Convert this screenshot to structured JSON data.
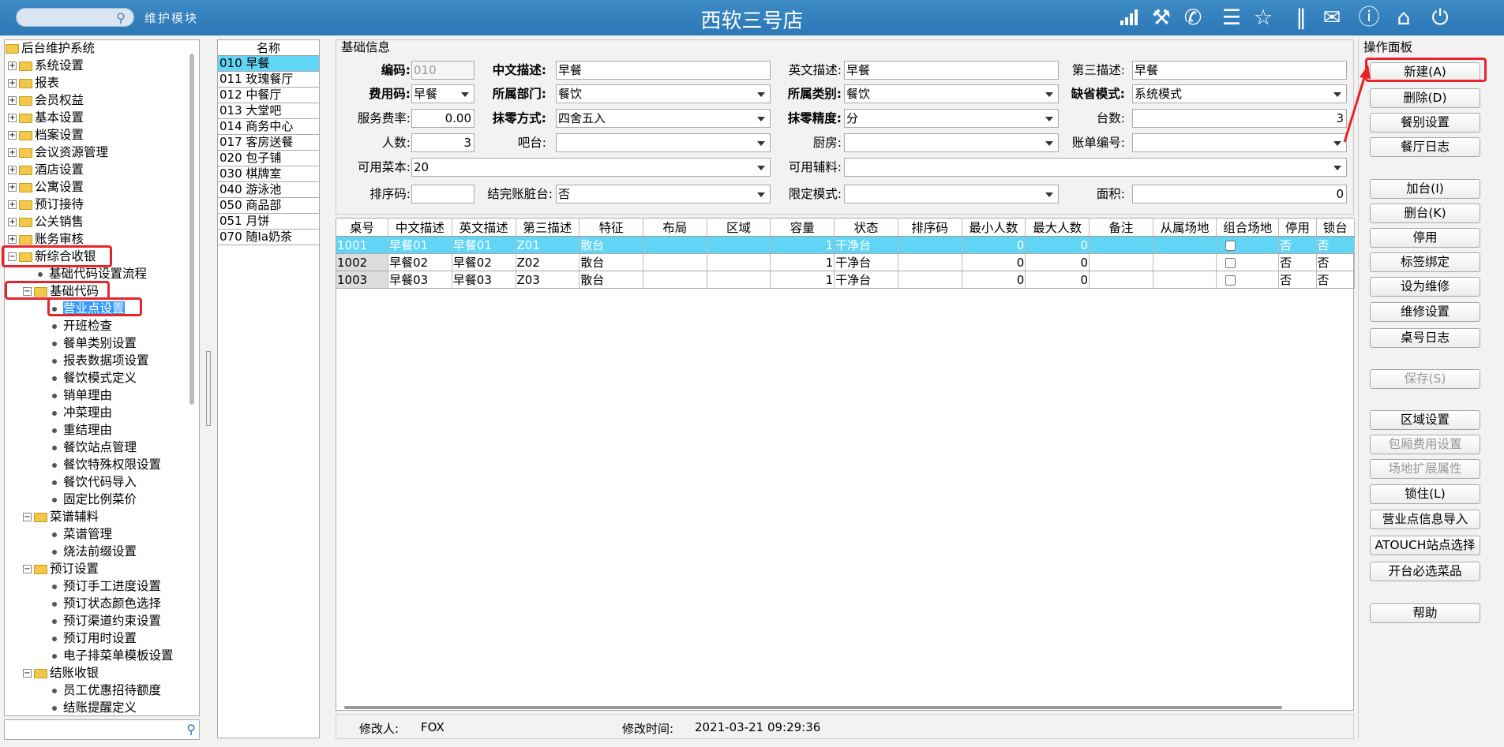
{
  "topbar": {
    "search_placeholder": "",
    "module_label": "维护模块",
    "app_title": "西软三号店",
    "icons": [
      "signal-icon",
      "tools-icon",
      "phone-icon",
      "menu-icon",
      "star-icon",
      "columns-icon",
      "mail-icon",
      "help-icon",
      "home-icon",
      "power-icon"
    ]
  },
  "tree": {
    "root": "后台维护系统",
    "top_items": [
      "系统设置",
      "报表",
      "会员权益",
      "基本设置",
      "档案设置",
      "会议资源管理",
      "酒店设置",
      "公寓设置",
      "预订接待",
      "公关销售",
      "账务审核"
    ],
    "new_pos": "新综合收银",
    "base_flow": "基础代码设置流程",
    "base_code": "基础代码",
    "base_code_children": [
      "营业点设置",
      "开班检查",
      "餐单类别设置",
      "报表数据项设置",
      "餐饮模式定义",
      "销单理由",
      "冲菜理由",
      "重结理由",
      "餐饮站点管理",
      "餐饮特殊权限设置",
      "餐饮代码导入",
      "固定比例菜价"
    ],
    "menu_aux": "菜谱辅料",
    "menu_aux_children": [
      "菜谱管理",
      "烧法前缀设置"
    ],
    "booking": "预订设置",
    "booking_children": [
      "预订手工进度设置",
      "预订状态颜色选择",
      "预订渠道约束设置",
      "预订用时设置",
      "电子排菜单模板设置"
    ],
    "checkout": "结账收银",
    "checkout_children": [
      "员工优惠招待额度",
      "结账提醒定义"
    ]
  },
  "names_list": {
    "header": "名称",
    "rows": [
      "010 早餐",
      "011 玫瑰餐厅",
      "012 中餐厅",
      "013 大堂吧",
      "014 商务中心",
      "017 客房送餐",
      "020 包子铺",
      "030 棋牌室",
      "040 游泳池",
      "050 商品部",
      "051 月饼",
      "070 随Ia奶茶"
    ]
  },
  "basic_info": {
    "title": "基础信息",
    "code_label": "编码:",
    "code_value": "010",
    "cn_desc_label": "中文描述:",
    "cn_desc_value": "早餐",
    "en_desc_label": "英文描述:",
    "en_desc_value": "早餐",
    "third_desc_label": "第三描述:",
    "third_desc_value": "早餐",
    "fee_code_label": "费用码:",
    "fee_code_value": "早餐",
    "dept_label": "所属部门:",
    "dept_value": "餐饮",
    "category_label": "所属类别:",
    "category_value": "餐饮",
    "default_mode_label": "缺省模式:",
    "default_mode_value": "系统模式",
    "service_rate_label": "服务费率:",
    "service_rate_value": "0.00",
    "rounding_label": "抹零方式:",
    "rounding_value": "四舍五入",
    "precision_label": "抹零精度:",
    "precision_value": "分",
    "tables_label": "台数:",
    "tables_value": "3",
    "people_label": "人数:",
    "people_value": "3",
    "bar_label": "吧台:",
    "bar_value": "",
    "kitchen_label": "厨房:",
    "kitchen_value": "",
    "bill_no_label": "账单编号:",
    "bill_no_value": "",
    "menu_label": "可用菜本:",
    "menu_value": "20",
    "aux_label": "可用辅料:",
    "aux_value": "",
    "sort_label": "排序码:",
    "sort_value": "",
    "dirty_label": "结完账脏台:",
    "dirty_value": "否",
    "limit_label": "限定模式:",
    "limit_value": "",
    "area_label": "面积:",
    "area_value": "0"
  },
  "grid": {
    "columns": [
      "桌号",
      "中文描述",
      "英文描述",
      "第三描述",
      "特征",
      "布局",
      "区域",
      "容量",
      "状态",
      "排序码",
      "最小人数",
      "最大人数",
      "备注",
      "从属场地",
      "组合场地",
      "停用",
      "锁台"
    ],
    "rows": [
      [
        "1001",
        "早餐01",
        "早餐01",
        "Z01",
        "散台",
        "",
        "",
        "1",
        "干净台",
        "",
        "0",
        "0",
        "",
        "",
        "",
        "否",
        "否"
      ],
      [
        "1002",
        "早餐02",
        "早餐02",
        "Z02",
        "散台",
        "",
        "",
        "1",
        "干净台",
        "",
        "0",
        "0",
        "",
        "",
        "",
        "否",
        "否"
      ],
      [
        "1003",
        "早餐03",
        "早餐03",
        "Z03",
        "散台",
        "",
        "",
        "1",
        "干净台",
        "",
        "0",
        "0",
        "",
        "",
        "",
        "否",
        "否"
      ]
    ]
  },
  "status": {
    "modifier_label": "修改人:",
    "modifier_value": "FOX",
    "modtime_label": "修改时间:",
    "modtime_value": "2021-03-21 09:29:36"
  },
  "panel": {
    "title": "操作面板",
    "buttons": [
      "新建(A)",
      "删除(D)",
      "餐别设置",
      "餐厅日志",
      "加台(I)",
      "删台(K)",
      "停用",
      "标签绑定",
      "设为维修",
      "维修设置",
      "桌号日志",
      "保存(S)",
      "区域设置",
      "包厢费用设置",
      "场地扩展属性",
      "锁住(L)",
      "营业点信息导入",
      "ATOUCH站点选择",
      "开台必选菜品",
      "帮助"
    ]
  },
  "colors": {
    "topbar": "#2f7dbd",
    "selection": "#61d5f5",
    "tree_selection": "#3399ff",
    "highlight": "#e8232a"
  }
}
